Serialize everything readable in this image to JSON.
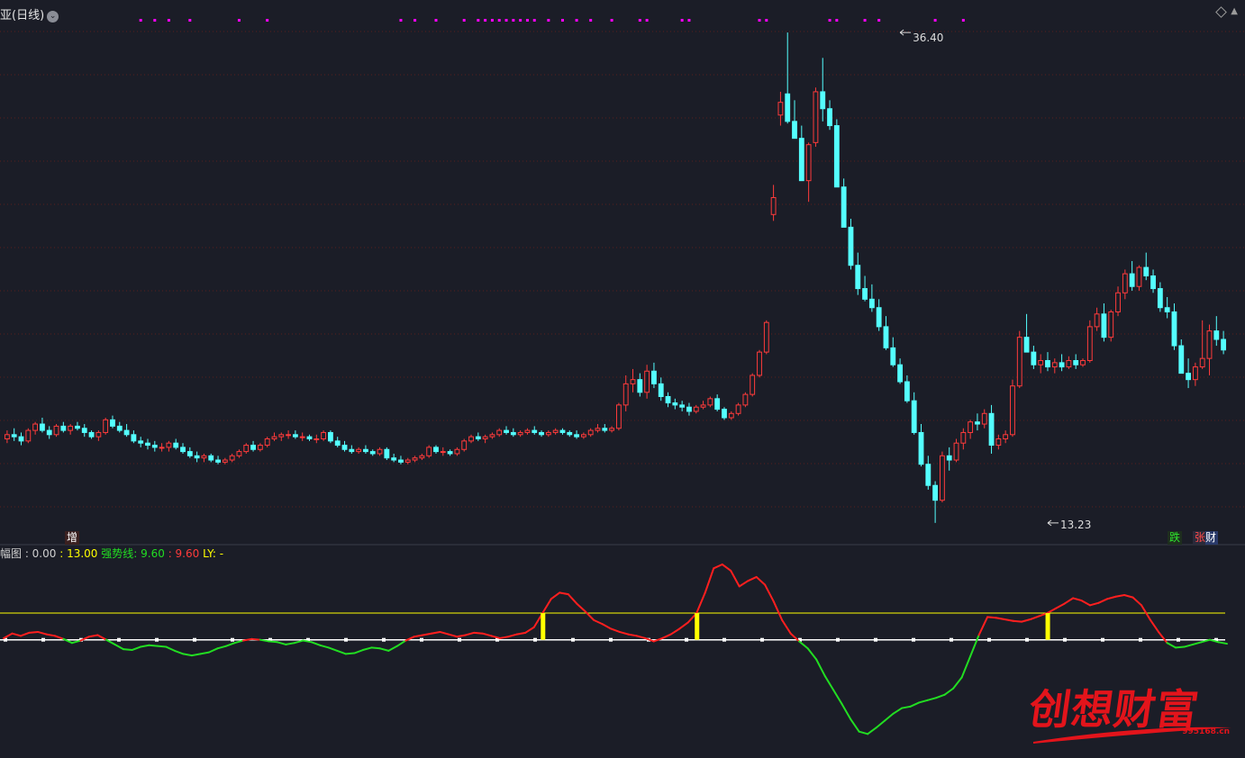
{
  "header": {
    "title": "亚(日线)",
    "menu_icon": "chevron-down-icon"
  },
  "price_labels": {
    "high": "36.40",
    "low": "13.23"
  },
  "badges": {
    "zeng": "增",
    "die": "跌",
    "zhang": "张",
    "cai": "财"
  },
  "indicator_legend": {
    "name": "幅图 : 0.00",
    "v1": ": 13.00",
    "v2": "强势线: 9.60",
    "v3": ": 9.60",
    "v4": "LY: -"
  },
  "watermark": {
    "text": "创想财富",
    "url": "995168.cn"
  },
  "colors": {
    "up": "#ff3b3b",
    "down": "#54ffff",
    "signal": "#ff00ff",
    "threshold": "#ffff00",
    "line_up": "#ff1f1f",
    "line_down": "#22dd22",
    "background": "#1b1d27",
    "grid": "#5a1e1e"
  },
  "chart_data": [
    {
      "type": "candlestick",
      "title": "",
      "ylim": [
        12.5,
        37.0
      ],
      "annotations": [
        {
          "label": "36.40",
          "value": 36.4,
          "index": 127
        },
        {
          "label": "13.23",
          "value": 13.23,
          "index": 148
        }
      ],
      "candles": [
        [
          17.2,
          17.6,
          17.0,
          17.4
        ],
        [
          17.4,
          17.7,
          17.1,
          17.3
        ],
        [
          17.3,
          17.5,
          16.9,
          17.1
        ],
        [
          17.1,
          17.7,
          17.0,
          17.6
        ],
        [
          17.6,
          18.0,
          17.4,
          17.9
        ],
        [
          17.9,
          18.2,
          17.5,
          17.6
        ],
        [
          17.6,
          17.8,
          17.2,
          17.4
        ],
        [
          17.4,
          17.9,
          17.3,
          17.8
        ],
        [
          17.8,
          18.0,
          17.5,
          17.6
        ],
        [
          17.6,
          17.9,
          17.4,
          17.8
        ],
        [
          17.8,
          18.0,
          17.6,
          17.7
        ],
        [
          17.7,
          17.9,
          17.3,
          17.5
        ],
        [
          17.5,
          17.6,
          17.2,
          17.3
        ],
        [
          17.3,
          17.6,
          17.1,
          17.5
        ],
        [
          17.5,
          18.2,
          17.4,
          18.1
        ],
        [
          18.1,
          18.3,
          17.7,
          17.8
        ],
        [
          17.8,
          18.0,
          17.5,
          17.6
        ],
        [
          17.6,
          17.9,
          17.3,
          17.4
        ],
        [
          17.4,
          17.6,
          17.0,
          17.1
        ],
        [
          17.1,
          17.3,
          16.8,
          17.0
        ],
        [
          17.0,
          17.2,
          16.7,
          16.9
        ],
        [
          16.9,
          17.1,
          16.6,
          16.8
        ],
        [
          16.8,
          17.0,
          16.6,
          16.8
        ],
        [
          16.8,
          17.1,
          16.6,
          17.0
        ],
        [
          17.0,
          17.2,
          16.7,
          16.8
        ],
        [
          16.8,
          17.0,
          16.5,
          16.6
        ],
        [
          16.6,
          16.8,
          16.3,
          16.4
        ],
        [
          16.4,
          16.6,
          16.1,
          16.3
        ],
        [
          16.3,
          16.5,
          16.1,
          16.4
        ],
        [
          16.4,
          16.5,
          16.1,
          16.2
        ],
        [
          16.2,
          16.4,
          16.0,
          16.1
        ],
        [
          16.1,
          16.3,
          16.0,
          16.2
        ],
        [
          16.2,
          16.5,
          16.1,
          16.4
        ],
        [
          16.4,
          16.7,
          16.3,
          16.6
        ],
        [
          16.6,
          17.0,
          16.5,
          16.9
        ],
        [
          16.9,
          17.1,
          16.6,
          16.7
        ],
        [
          16.7,
          17.0,
          16.6,
          16.9
        ],
        [
          16.9,
          17.3,
          16.8,
          17.2
        ],
        [
          17.2,
          17.5,
          17.1,
          17.3
        ],
        [
          17.3,
          17.5,
          17.1,
          17.4
        ],
        [
          17.4,
          17.6,
          17.2,
          17.4
        ],
        [
          17.4,
          17.6,
          17.2,
          17.3
        ],
        [
          17.3,
          17.5,
          17.1,
          17.3
        ],
        [
          17.3,
          17.4,
          17.1,
          17.2
        ],
        [
          17.2,
          17.4,
          17.0,
          17.2
        ],
        [
          17.2,
          17.6,
          17.1,
          17.5
        ],
        [
          17.5,
          17.6,
          17.0,
          17.1
        ],
        [
          17.1,
          17.3,
          16.8,
          16.9
        ],
        [
          16.9,
          17.1,
          16.6,
          16.7
        ],
        [
          16.7,
          16.9,
          16.5,
          16.6
        ],
        [
          16.6,
          16.8,
          16.5,
          16.7
        ],
        [
          16.7,
          16.9,
          16.5,
          16.6
        ],
        [
          16.6,
          16.7,
          16.4,
          16.5
        ],
        [
          16.5,
          16.8,
          16.4,
          16.7
        ],
        [
          16.7,
          16.8,
          16.2,
          16.3
        ],
        [
          16.3,
          16.5,
          16.1,
          16.2
        ],
        [
          16.2,
          16.4,
          16.0,
          16.1
        ],
        [
          16.1,
          16.3,
          16.0,
          16.2
        ],
        [
          16.2,
          16.4,
          16.1,
          16.3
        ],
        [
          16.3,
          16.5,
          16.2,
          16.4
        ],
        [
          16.4,
          16.9,
          16.3,
          16.8
        ],
        [
          16.8,
          16.9,
          16.5,
          16.6
        ],
        [
          16.6,
          16.8,
          16.4,
          16.6
        ],
        [
          16.6,
          16.7,
          16.4,
          16.5
        ],
        [
          16.5,
          16.8,
          16.4,
          16.7
        ],
        [
          16.7,
          17.2,
          16.6,
          17.1
        ],
        [
          17.1,
          17.4,
          17.0,
          17.3
        ],
        [
          17.3,
          17.5,
          17.1,
          17.2
        ],
        [
          17.2,
          17.4,
          17.0,
          17.3
        ],
        [
          17.3,
          17.5,
          17.2,
          17.4
        ],
        [
          17.4,
          17.7,
          17.3,
          17.6
        ],
        [
          17.6,
          17.8,
          17.4,
          17.5
        ],
        [
          17.5,
          17.7,
          17.3,
          17.4
        ],
        [
          17.4,
          17.6,
          17.3,
          17.5
        ],
        [
          17.5,
          17.7,
          17.4,
          17.6
        ],
        [
          17.6,
          17.8,
          17.4,
          17.5
        ],
        [
          17.5,
          17.6,
          17.3,
          17.4
        ],
        [
          17.4,
          17.6,
          17.3,
          17.5
        ],
        [
          17.5,
          17.7,
          17.4,
          17.6
        ],
        [
          17.6,
          17.7,
          17.4,
          17.5
        ],
        [
          17.5,
          17.6,
          17.3,
          17.4
        ],
        [
          17.4,
          17.6,
          17.2,
          17.3
        ],
        [
          17.3,
          17.5,
          17.2,
          17.4
        ],
        [
          17.4,
          17.7,
          17.3,
          17.6
        ],
        [
          17.6,
          17.9,
          17.5,
          17.7
        ],
        [
          17.7,
          17.9,
          17.5,
          17.6
        ],
        [
          17.6,
          17.8,
          17.5,
          17.7
        ],
        [
          17.7,
          18.9,
          17.6,
          18.8
        ],
        [
          18.8,
          20.2,
          18.5,
          19.8
        ],
        [
          19.8,
          20.5,
          19.4,
          20.0
        ],
        [
          20.0,
          20.3,
          19.2,
          19.4
        ],
        [
          19.4,
          20.7,
          19.1,
          20.4
        ],
        [
          20.4,
          20.8,
          19.6,
          19.8
        ],
        [
          19.8,
          20.1,
          19.0,
          19.2
        ],
        [
          19.2,
          19.4,
          18.7,
          18.9
        ],
        [
          18.9,
          19.1,
          18.6,
          18.8
        ],
        [
          18.8,
          19.0,
          18.5,
          18.7
        ],
        [
          18.7,
          18.9,
          18.3,
          18.5
        ],
        [
          18.5,
          18.8,
          18.4,
          18.7
        ],
        [
          18.7,
          19.0,
          18.6,
          18.8
        ],
        [
          18.8,
          19.2,
          18.7,
          19.1
        ],
        [
          19.1,
          19.3,
          18.5,
          18.6
        ],
        [
          18.6,
          18.7,
          18.1,
          18.2
        ],
        [
          18.2,
          18.5,
          18.1,
          18.4
        ],
        [
          18.4,
          18.9,
          18.3,
          18.8
        ],
        [
          18.8,
          19.4,
          18.7,
          19.3
        ],
        [
          19.3,
          20.3,
          19.2,
          20.2
        ],
        [
          20.2,
          21.4,
          20.1,
          21.3
        ],
        [
          21.3,
          22.8,
          21.2,
          22.7
        ],
        [
          27.8,
          29.2,
          27.5,
          28.6
        ],
        [
          32.5,
          33.6,
          32.0,
          33.1
        ],
        [
          33.5,
          36.4,
          32.1,
          32.2
        ],
        [
          32.2,
          33.2,
          31.6,
          31.4
        ],
        [
          31.4,
          32.0,
          29.5,
          29.4
        ],
        [
          29.4,
          31.2,
          28.4,
          31.1
        ],
        [
          31.2,
          33.8,
          31.0,
          33.6
        ],
        [
          33.6,
          35.2,
          32.2,
          32.8
        ],
        [
          32.8,
          33.2,
          31.8,
          32.0
        ],
        [
          32.0,
          32.3,
          29.2,
          29.1
        ],
        [
          29.1,
          29.5,
          27.2,
          27.2
        ],
        [
          27.2,
          27.6,
          25.2,
          25.4
        ],
        [
          25.4,
          26.0,
          24.0,
          24.3
        ],
        [
          24.3,
          24.9,
          23.7,
          23.8
        ],
        [
          23.8,
          24.5,
          23.2,
          23.4
        ],
        [
          23.4,
          23.8,
          22.3,
          22.5
        ],
        [
          22.5,
          23.0,
          21.4,
          21.5
        ],
        [
          21.5,
          22.0,
          20.6,
          20.7
        ],
        [
          20.7,
          21.0,
          19.8,
          19.9
        ],
        [
          19.9,
          20.2,
          18.9,
          19.0
        ],
        [
          19.0,
          19.4,
          17.4,
          17.5
        ],
        [
          17.5,
          17.9,
          15.9,
          16.0
        ],
        [
          16.0,
          16.4,
          14.8,
          15.0
        ],
        [
          15.0,
          15.2,
          13.23,
          14.3
        ],
        [
          14.3,
          16.6,
          14.2,
          16.4
        ],
        [
          16.4,
          16.8,
          15.7,
          16.2
        ],
        [
          16.2,
          17.2,
          16.1,
          17.0
        ],
        [
          17.0,
          17.7,
          16.7,
          17.5
        ],
        [
          17.5,
          18.1,
          17.2,
          18.0
        ],
        [
          18.0,
          18.4,
          17.6,
          17.9
        ],
        [
          17.9,
          18.6,
          17.7,
          18.4
        ],
        [
          18.4,
          18.8,
          16.5,
          16.9
        ],
        [
          16.9,
          17.4,
          16.7,
          17.2
        ],
        [
          17.2,
          17.6,
          17.0,
          17.4
        ],
        [
          17.4,
          20.0,
          17.3,
          19.7
        ],
        [
          19.7,
          22.3,
          19.6,
          22.0
        ],
        [
          22.0,
          23.1,
          21.7,
          21.3
        ],
        [
          21.3,
          21.6,
          20.5,
          20.7
        ],
        [
          20.7,
          21.2,
          20.3,
          20.9
        ],
        [
          20.9,
          21.3,
          20.4,
          20.6
        ],
        [
          20.6,
          21.0,
          20.3,
          20.8
        ],
        [
          20.8,
          21.2,
          20.4,
          20.6
        ],
        [
          20.6,
          21.1,
          20.5,
          20.9
        ],
        [
          20.9,
          21.2,
          20.5,
          20.7
        ],
        [
          20.7,
          21.0,
          20.6,
          20.9
        ],
        [
          20.9,
          22.8,
          20.8,
          22.5
        ],
        [
          22.5,
          23.4,
          22.3,
          23.1
        ],
        [
          23.1,
          23.6,
          21.8,
          22.0
        ],
        [
          22.0,
          23.3,
          21.8,
          23.2
        ],
        [
          23.2,
          24.4,
          23.0,
          24.1
        ],
        [
          24.1,
          25.2,
          23.8,
          25.0
        ],
        [
          25.0,
          25.6,
          24.2,
          24.4
        ],
        [
          24.4,
          25.4,
          24.2,
          25.3
        ],
        [
          25.3,
          26.0,
          24.7,
          24.9
        ],
        [
          24.9,
          25.2,
          24.1,
          24.3
        ],
        [
          24.3,
          24.6,
          23.2,
          23.4
        ],
        [
          23.4,
          23.9,
          22.9,
          23.2
        ],
        [
          23.2,
          23.6,
          21.4,
          21.6
        ],
        [
          21.6,
          21.9,
          20.4,
          20.3
        ],
        [
          20.3,
          21.0,
          19.6,
          20.0
        ],
        [
          20.0,
          20.8,
          19.7,
          20.6
        ],
        [
          20.6,
          22.8,
          20.5,
          21.0
        ],
        [
          21.0,
          22.6,
          20.2,
          22.3
        ],
        [
          22.3,
          23.0,
          21.6,
          21.9
        ],
        [
          21.9,
          22.3,
          21.2,
          21.4
        ]
      ],
      "signals": [
        19,
        21,
        23,
        26,
        33,
        37,
        56,
        58,
        61,
        65,
        67,
        68,
        69,
        70,
        71,
        72,
        73,
        74,
        75,
        77,
        79,
        81,
        83,
        86,
        90,
        91,
        96,
        97,
        107,
        108,
        117,
        118,
        122,
        124,
        132,
        136
      ],
      "signal_label": "",
      "badges": [
        "增",
        "跌",
        "张",
        "财"
      ]
    },
    {
      "type": "line",
      "title": "",
      "legend": [
        "幅图 : 0.00",
        ": 13.00",
        "强势线: 9.60",
        ": 9.60",
        "LY: -"
      ],
      "ylim": [
        -5,
        20
      ],
      "reference_lines": [
        13.0,
        9.6
      ],
      "values": [
        9.8,
        10.4,
        10.1,
        10.5,
        10.6,
        10.3,
        10.1,
        9.7,
        9.2,
        9.5,
        10.0,
        10.2,
        9.6,
        9.0,
        8.4,
        8.3,
        8.7,
        8.9,
        8.8,
        8.7,
        8.2,
        7.8,
        7.6,
        7.8,
        8.0,
        8.5,
        8.8,
        9.2,
        9.5,
        9.7,
        9.6,
        9.4,
        9.3,
        9.0,
        9.2,
        9.5,
        9.3,
        8.9,
        8.6,
        8.2,
        7.8,
        7.9,
        8.3,
        8.6,
        8.5,
        8.2,
        8.8,
        9.5,
        10.0,
        10.2,
        10.4,
        10.6,
        10.3,
        10.0,
        10.2,
        10.5,
        10.4,
        10.1,
        9.8,
        10.0,
        10.3,
        10.5,
        11.2,
        13.0,
        14.8,
        15.6,
        15.4,
        14.2,
        13.2,
        12.1,
        11.6,
        11.0,
        10.6,
        10.3,
        10.1,
        9.8,
        9.4,
        9.8,
        10.3,
        11.0,
        11.8,
        13.0,
        15.6,
        18.7,
        19.2,
        18.4,
        16.4,
        17.1,
        17.6,
        16.6,
        14.5,
        12.1,
        10.4,
        9.4,
        8.5,
        7.1,
        5.0,
        3.2,
        1.4,
        -0.5,
        -2.1,
        -2.4,
        -1.6,
        -0.7,
        0.2,
        0.9,
        1.1,
        1.6,
        1.9,
        2.2,
        2.6,
        3.4,
        4.8,
        7.5,
        10.2,
        12.5,
        12.4,
        12.2,
        12.0,
        11.9,
        12.2,
        12.6,
        13.0,
        13.6,
        14.2,
        14.9,
        14.6,
        14.0,
        14.3,
        14.8,
        15.1,
        15.3,
        15.0,
        14.0,
        12.2,
        10.6,
        9.2,
        8.6,
        8.7,
        9.0,
        9.3,
        9.6,
        9.3,
        9.1
      ]
    }
  ]
}
